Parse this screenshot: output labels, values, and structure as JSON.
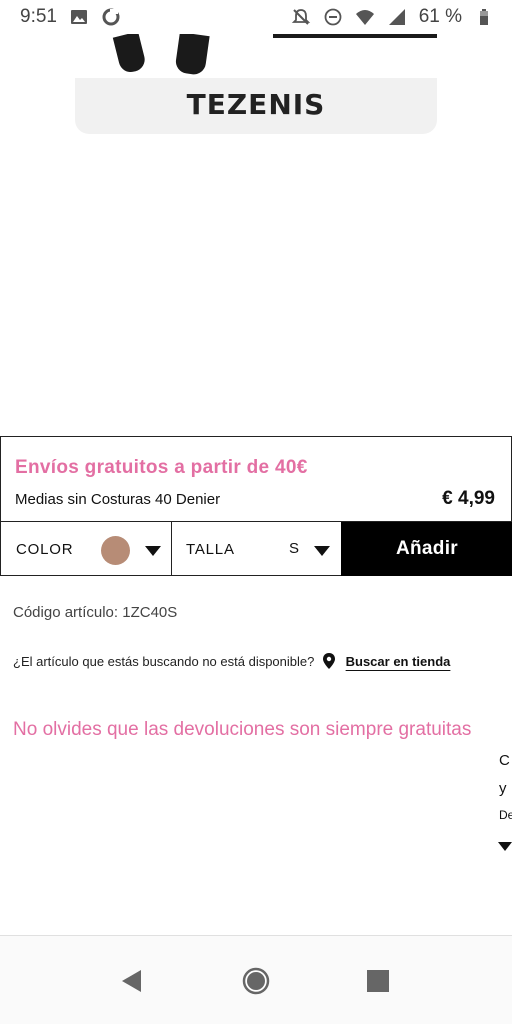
{
  "status_bar": {
    "time": "9:51",
    "battery_text": "61 %",
    "icons": [
      "image-icon",
      "sync-icon",
      "notifications-off-icon",
      "do-not-disturb-icon",
      "wifi-icon",
      "signal-icon",
      "battery-icon"
    ]
  },
  "product_image": {
    "brand": "TEZENIS"
  },
  "promo": {
    "text": "Envíos gratuitos a partir de 40€"
  },
  "product": {
    "name": "Medias sin Costuras 40 Denier",
    "price": "€ 4,99"
  },
  "selectors": {
    "color_label": "COLOR",
    "color_swatch": "#b78c76",
    "size_label": "TALLA",
    "size_value": "S",
    "add_button": "Añadir"
  },
  "sku": {
    "text": "Código artículo: 1ZC40S"
  },
  "availability": {
    "question": "¿El artículo que estás buscando no está disponible?",
    "link": "Buscar en tienda"
  },
  "returns_note": "No olvides que las devoluciones son siempre gratuitas",
  "edge_fragments": [
    "C",
    "y",
    "De"
  ],
  "colors": {
    "accent_pink": "#e36fa3",
    "button_black": "#000000"
  },
  "nav_bar": {
    "icons": [
      "back-icon",
      "home-icon",
      "recents-icon"
    ]
  }
}
